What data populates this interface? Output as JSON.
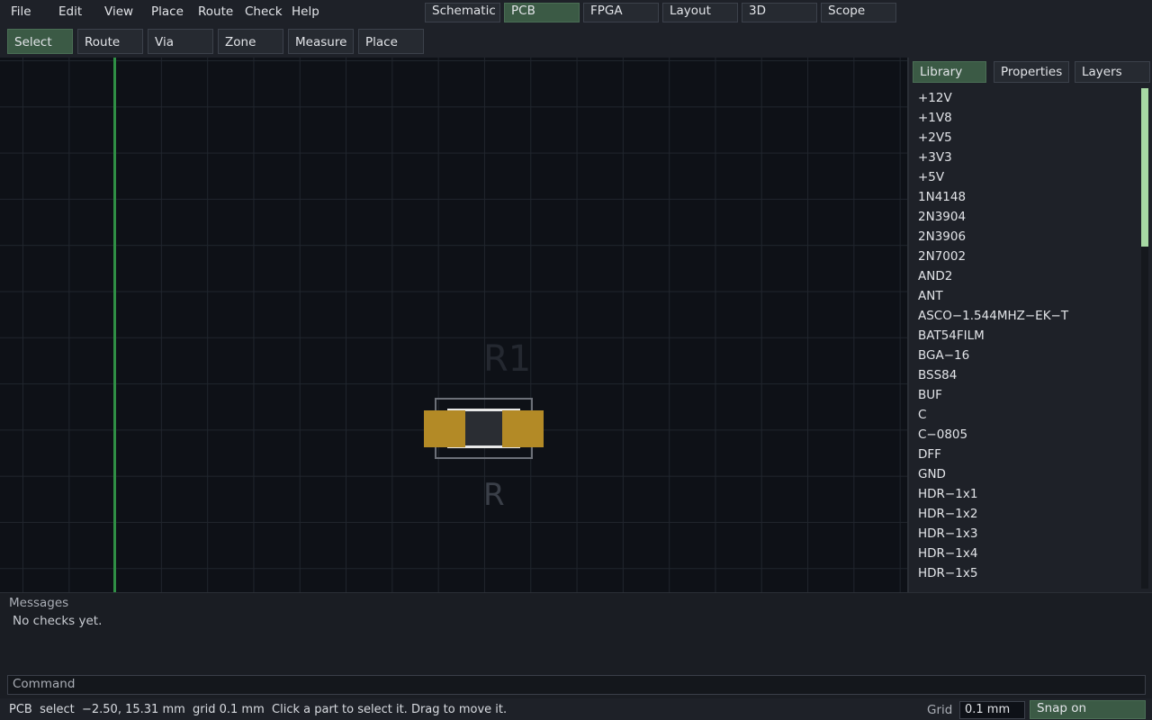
{
  "menu": {
    "items": [
      "File",
      "Edit",
      "View",
      "Place",
      "Route",
      "Check",
      "Help"
    ]
  },
  "modes": {
    "tabs": [
      "Schematic",
      "PCB",
      "FPGA",
      "Layout",
      "3D",
      "Scope"
    ],
    "active": "PCB"
  },
  "toolbar": {
    "tools": [
      "Select",
      "Route",
      "Via",
      "Zone",
      "Measure",
      "Place"
    ],
    "active": "Select"
  },
  "canvas": {
    "component_ref": "R1",
    "component_value": "R",
    "colors": {
      "background": "#0e1117",
      "track": "#2f8f45",
      "pad": "#b38a26"
    }
  },
  "panel": {
    "tabs": [
      "Library",
      "Properties",
      "Layers"
    ],
    "active": "Library",
    "library_items": [
      "+12V",
      "+1V8",
      "+2V5",
      "+3V3",
      "+5V",
      "1N4148",
      "2N3904",
      "2N3906",
      "2N7002",
      "AND2",
      "ANT",
      "ASCO−1.544MHZ−EK−T",
      "BAT54FILM",
      "BGA−16",
      "BSS84",
      "BUF",
      "C",
      "C−0805",
      "DFF",
      "GND",
      "HDR−1x1",
      "HDR−1x2",
      "HDR−1x3",
      "HDR−1x4",
      "HDR−1x5"
    ]
  },
  "messages": {
    "title": "Messages",
    "text": "No checks yet."
  },
  "command": {
    "placeholder": "Command"
  },
  "status": {
    "text": "PCB  select  −2.50, 15.31 mm  grid 0.1 mm  Click a part to select it. Drag to move it.",
    "grid_label": "Grid",
    "grid_value": "0.1 mm",
    "snap_label": "Snap on"
  },
  "accent_color": "#3b5a45"
}
